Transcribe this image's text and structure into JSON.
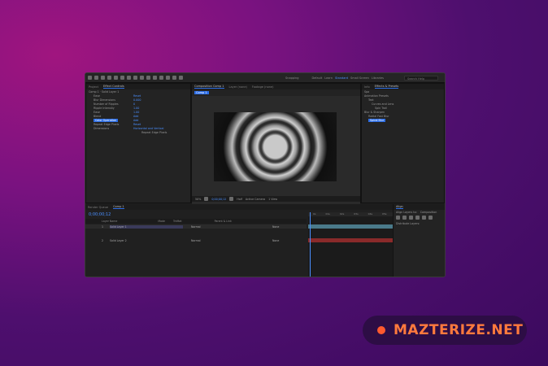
{
  "toolbar": {
    "snapping": "Snapping",
    "default": "Default",
    "learn": "Learn",
    "standard": "Standard",
    "small_screen": "Small Screen",
    "libraries": "Libraries",
    "search_placeholder": "Search Help"
  },
  "project_panel": {
    "tab_project": "Project",
    "tab_effect_controls": "Effect Controls",
    "layer_path": "Comp 1 · Solid Layer 1",
    "properties": [
      {
        "label": "Ease",
        "value": "Reset"
      },
      {
        "label": "Blur Dimensions",
        "value": "0.000"
      },
      {
        "label": "Number of Ripples",
        "value": "0"
      },
      {
        "label": "Ripple Intensity",
        "value": "1.00"
      },
      {
        "label": "Ease",
        "value": "1.00"
      },
      {
        "label": "Blend",
        "value": "Add"
      },
      {
        "label": "Color Operation",
        "value": "Add"
      },
      {
        "label": "Repeat Edge Pixels",
        "value": "Reset"
      },
      {
        "label": "Dimensions",
        "value": "Horizontal and Vertical"
      }
    ],
    "repeat_edge": "Repeat Edge Pixels"
  },
  "composition": {
    "tab": "Composition Comp 1",
    "layer_tab": "Layer (none)",
    "footage_tab": "Footage (none)",
    "comp_name": "Comp 1",
    "zoom": "50%",
    "time": "0;00;00;12",
    "resolution": "Half",
    "camera": "Active Camera",
    "view": "1 View"
  },
  "effects_panel": {
    "tab_info": "Info",
    "tab_effects": "Effects & Presets",
    "search_value": "Spa",
    "groups": [
      {
        "name": "Animation Presets",
        "children": [
          "Text",
          "Curves and Lens",
          "Spin Trail"
        ]
      },
      {
        "name": "Blur & Sharpen",
        "children": [
          "Radial Fast Blur",
          "Spiral Blur"
        ]
      }
    ]
  },
  "timeline": {
    "tab_render": "Render Queue",
    "tab_comp": "Comp 1",
    "time": "0;00;00;12",
    "columns": [
      "Layer Name",
      "Mode",
      "TrkMat",
      "Parent & Link"
    ],
    "layers": [
      {
        "num": "1",
        "name": "Solid Layer 1",
        "mode": "Normal",
        "parent": "None"
      },
      {
        "num": "2",
        "name": "Solid Layer 2",
        "mode": "Normal",
        "parent": "None"
      }
    ],
    "ruler": [
      "0s",
      "01s",
      "02s",
      "03s",
      "04s",
      "05s"
    ]
  },
  "align_panel": {
    "title": "Align",
    "align_to_label": "Align Layers to:",
    "align_to_value": "Composition",
    "distribute": "Distribute Layers:"
  },
  "brand": {
    "name": "MAZTERIZE.NET",
    "accent": "#ff5a2e"
  }
}
